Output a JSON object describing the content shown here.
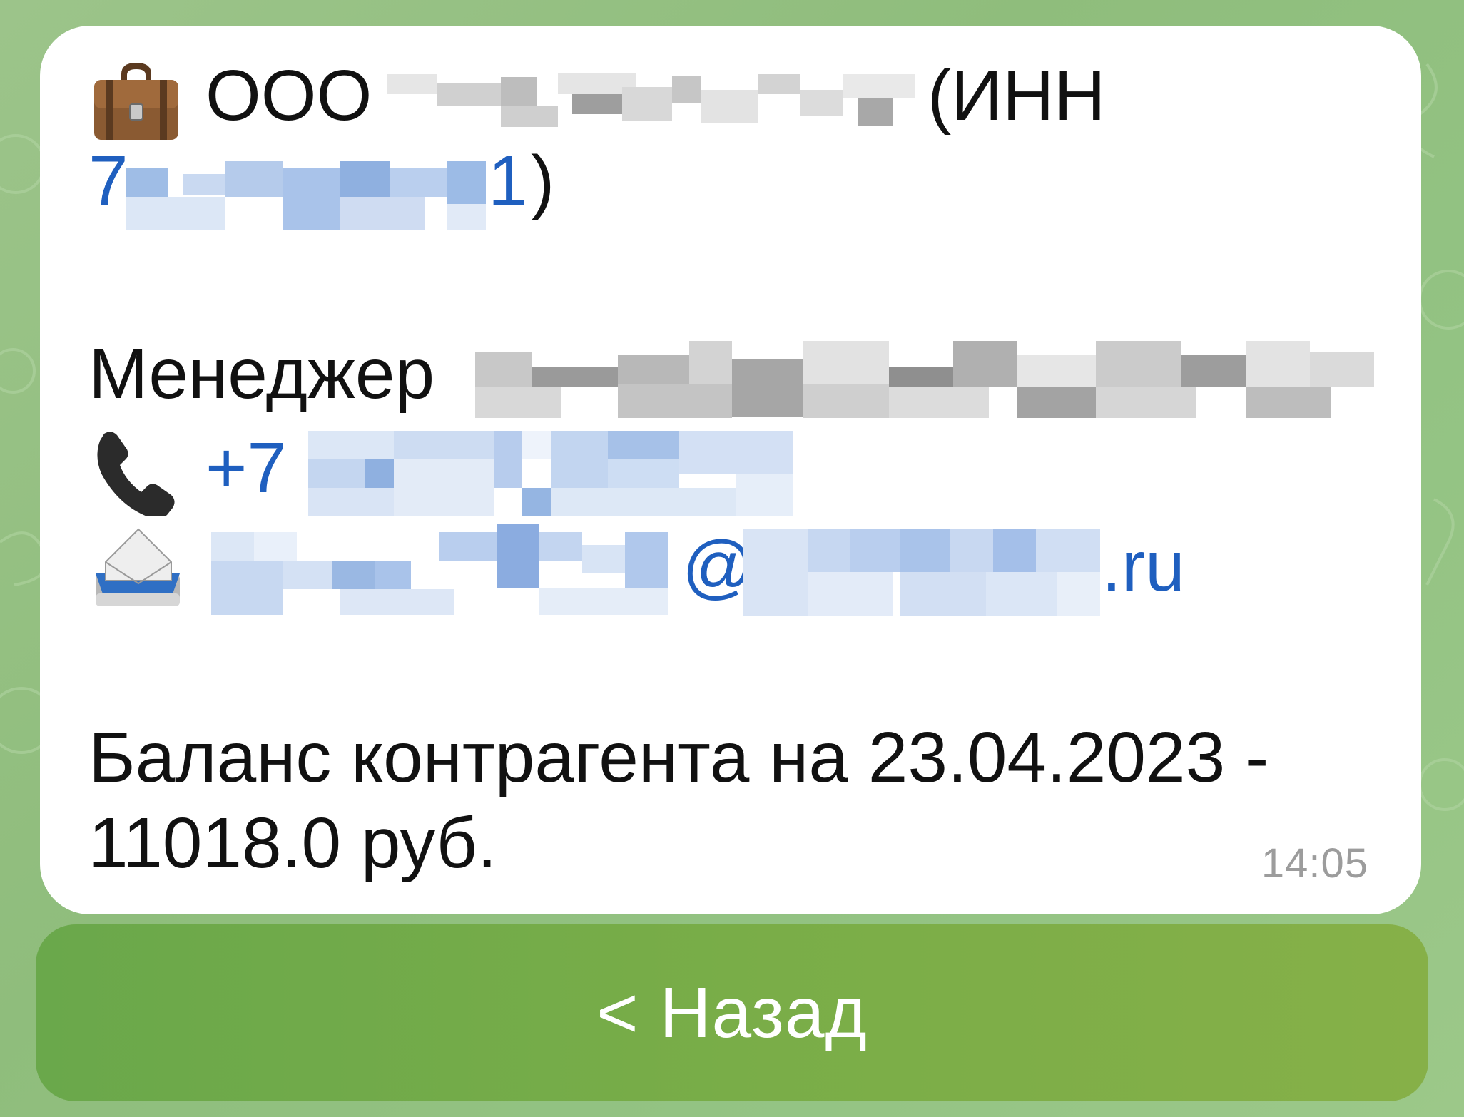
{
  "message": {
    "company_prefix": "ООО",
    "inn_open": "(ИНН",
    "inn_first_digit": "7",
    "inn_last_digit": "1",
    "inn_close": ")",
    "manager_label": "Менеджер",
    "phone_prefix": "+7",
    "email_at": "@",
    "email_domain_suffix": "ru",
    "balance_line1": "Баланс контрагента на 23.04.2023 -",
    "balance_line2": "11018.0 руб.",
    "time": "14:05",
    "icons": [
      "briefcase-icon",
      "telephone-icon",
      "incoming-envelope-icon"
    ]
  },
  "keyboard": {
    "back_button_label": "< Назад"
  },
  "colors": {
    "link": "#1f5fbf",
    "bubble": "#ffffff",
    "button": "#76ac49",
    "background": "#95c283"
  }
}
